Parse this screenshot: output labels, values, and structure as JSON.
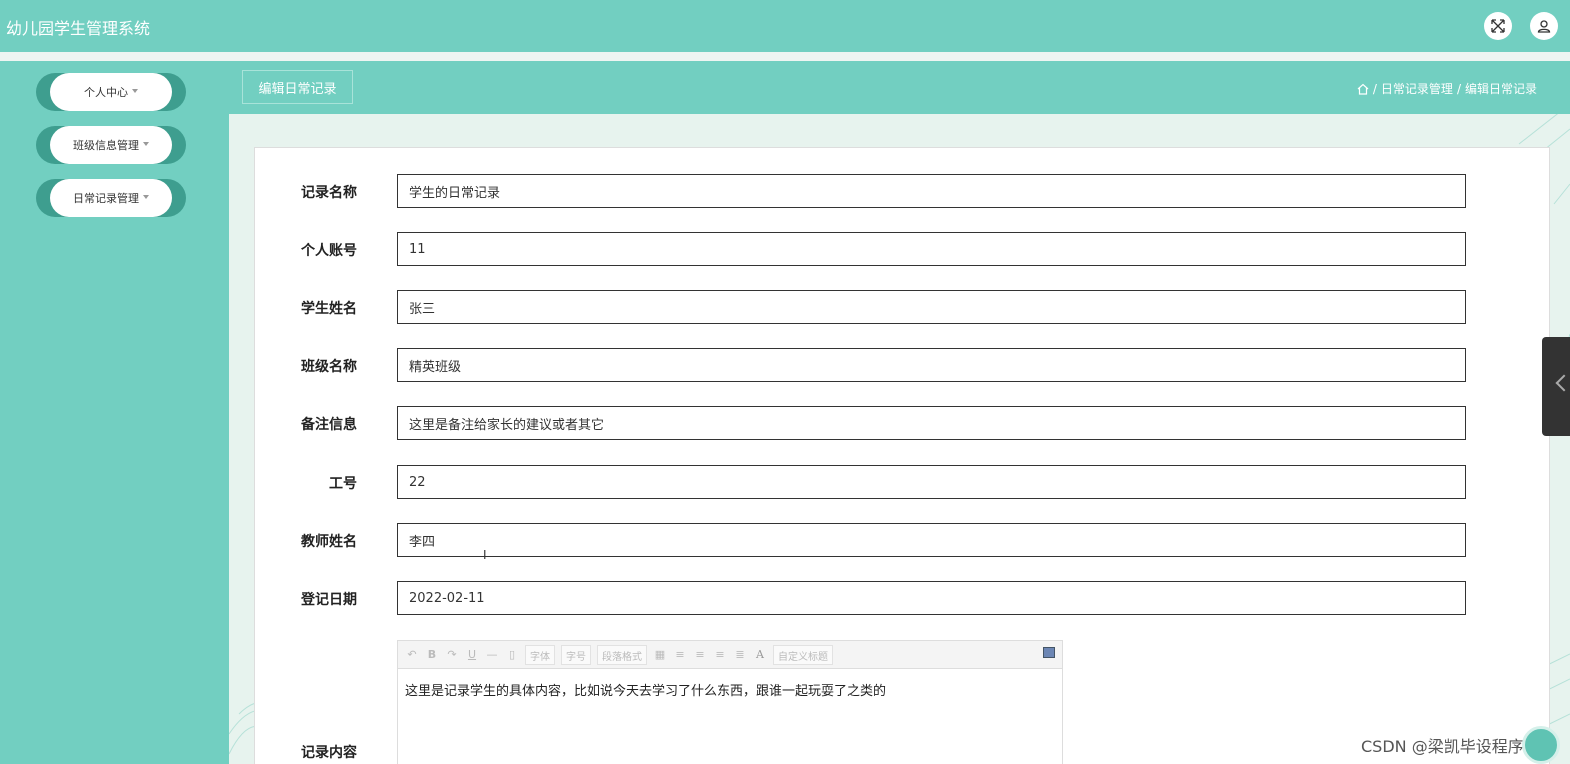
{
  "app": {
    "title": "幼儿园学生管理系统"
  },
  "header": {
    "fullscreen_icon": "fullscreen-icon",
    "user_icon": "user-icon"
  },
  "sidebar": {
    "items": [
      {
        "label": "个人中心"
      },
      {
        "label": "班级信息管理"
      },
      {
        "label": "日常记录管理"
      }
    ]
  },
  "page": {
    "title": "编辑日常记录",
    "breadcrumb": {
      "home_icon": "home-icon",
      "separator": "/",
      "level1": "日常记录管理",
      "level2": "编辑日常记录"
    }
  },
  "form": {
    "fields": [
      {
        "label": "记录名称",
        "value": "学生的日常记录"
      },
      {
        "label": "个人账号",
        "value": "11"
      },
      {
        "label": "学生姓名",
        "value": "张三"
      },
      {
        "label": "班级名称",
        "value": "精英班级"
      },
      {
        "label": "备注信息",
        "value": "这里是备注给家长的建议或者其它"
      },
      {
        "label": "工号",
        "value": "22"
      },
      {
        "label": "教师姓名",
        "value": "李四"
      },
      {
        "label": "登记日期",
        "value": "2022-02-11"
      }
    ],
    "content": {
      "label": "记录内容",
      "text": "这里是记录学生的具体内容，比如说今天去学习了什么东西，跟谁一起玩耍了之类的",
      "toolbar": {
        "font": "字体",
        "size": "字号",
        "paragraph": "段落格式",
        "font_color": "A",
        "custom_title": "自定义标题"
      }
    }
  },
  "watermark": "CSDN @梁凯毕设程序"
}
